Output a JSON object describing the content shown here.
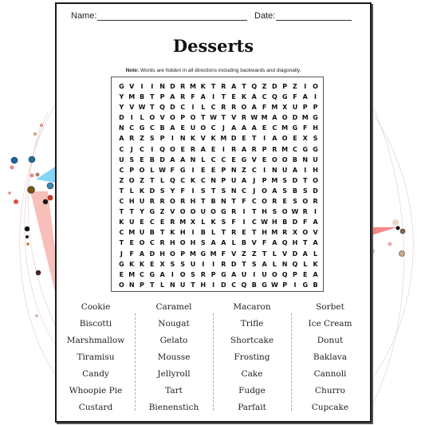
{
  "worksheet": {
    "name_label": "Name:",
    "date_label": "Date:",
    "title": "Desserts",
    "note_label": "Note:",
    "note_text": " Words are hidden in all directions including backwards and diagonally."
  },
  "grid_rows": [
    "GVIINDRMKTRATQZDPZIO",
    "YMBTPARFAITEKACQGFAI",
    "YVWTQDCILCRROAFMXUPP",
    "DILOVOPOTWTVRWMAODMG",
    "NCGCBAEUOCJAAAECMGFH",
    "ARZSPINKVKMDETIAOEXS",
    "CJCIQOERAEIRARPRMCGG",
    "USEBDAANLCCEGVEOOBNU",
    "CPOLWFGIEEPNZCINUAIH",
    "ZOZTLQCKCNPUAJPMSDTO",
    "TLKDSYFISTSNCJOASBSD",
    "CHURRORHTBNTFCORESOR",
    "TTYGZVOOUOGRITHSOWRI",
    "KUECERMXLKSFICWHBDFA",
    "CMUBTKHIBLTRETHMRXOV",
    "TEOCRHOHSAALBVFAQHTA",
    "JFADHOPMGMFVZZTLVDAL",
    "GKKEXSSUIIRDTSALNQLK",
    "EMCGAIOSRPGAUIUOQPEA",
    "ONPTLNUTHIDCQBGWPIGB"
  ],
  "word_columns": [
    [
      "Cookie",
      "Biscotti",
      "Marshmallow",
      "Tiramisu",
      "Candy",
      "Whoopie Pie",
      "Custard"
    ],
    [
      "Caramel",
      "Nougat",
      "Gelato",
      "Mousse",
      "Jellyroll",
      "Tart",
      "Bienenstich"
    ],
    [
      "Macaron",
      "Trifle",
      "Shortcake",
      "Frosting",
      "Cake",
      "Fudge",
      "Parfait"
    ],
    [
      "Sorbet",
      "Ice Cream",
      "Donut",
      "Baklava",
      "Cannoli",
      "Churro",
      "Cupcake"
    ]
  ],
  "decoration": {
    "nodes_left": [
      {
        "color": "#1f5fa8"
      },
      {
        "color": "#1f6fa0"
      },
      {
        "color": "#7a5410"
      },
      {
        "color": "#d9534f"
      },
      {
        "color": "#111111"
      },
      {
        "color": "#c0392b"
      },
      {
        "color": "#5a1a2a"
      },
      {
        "color": "#3a87b5"
      }
    ],
    "accent_colors": {
      "red_fan": "#f28b82",
      "cyan_fan": "#4fc3f7",
      "edge": "#d8b4b4"
    }
  }
}
